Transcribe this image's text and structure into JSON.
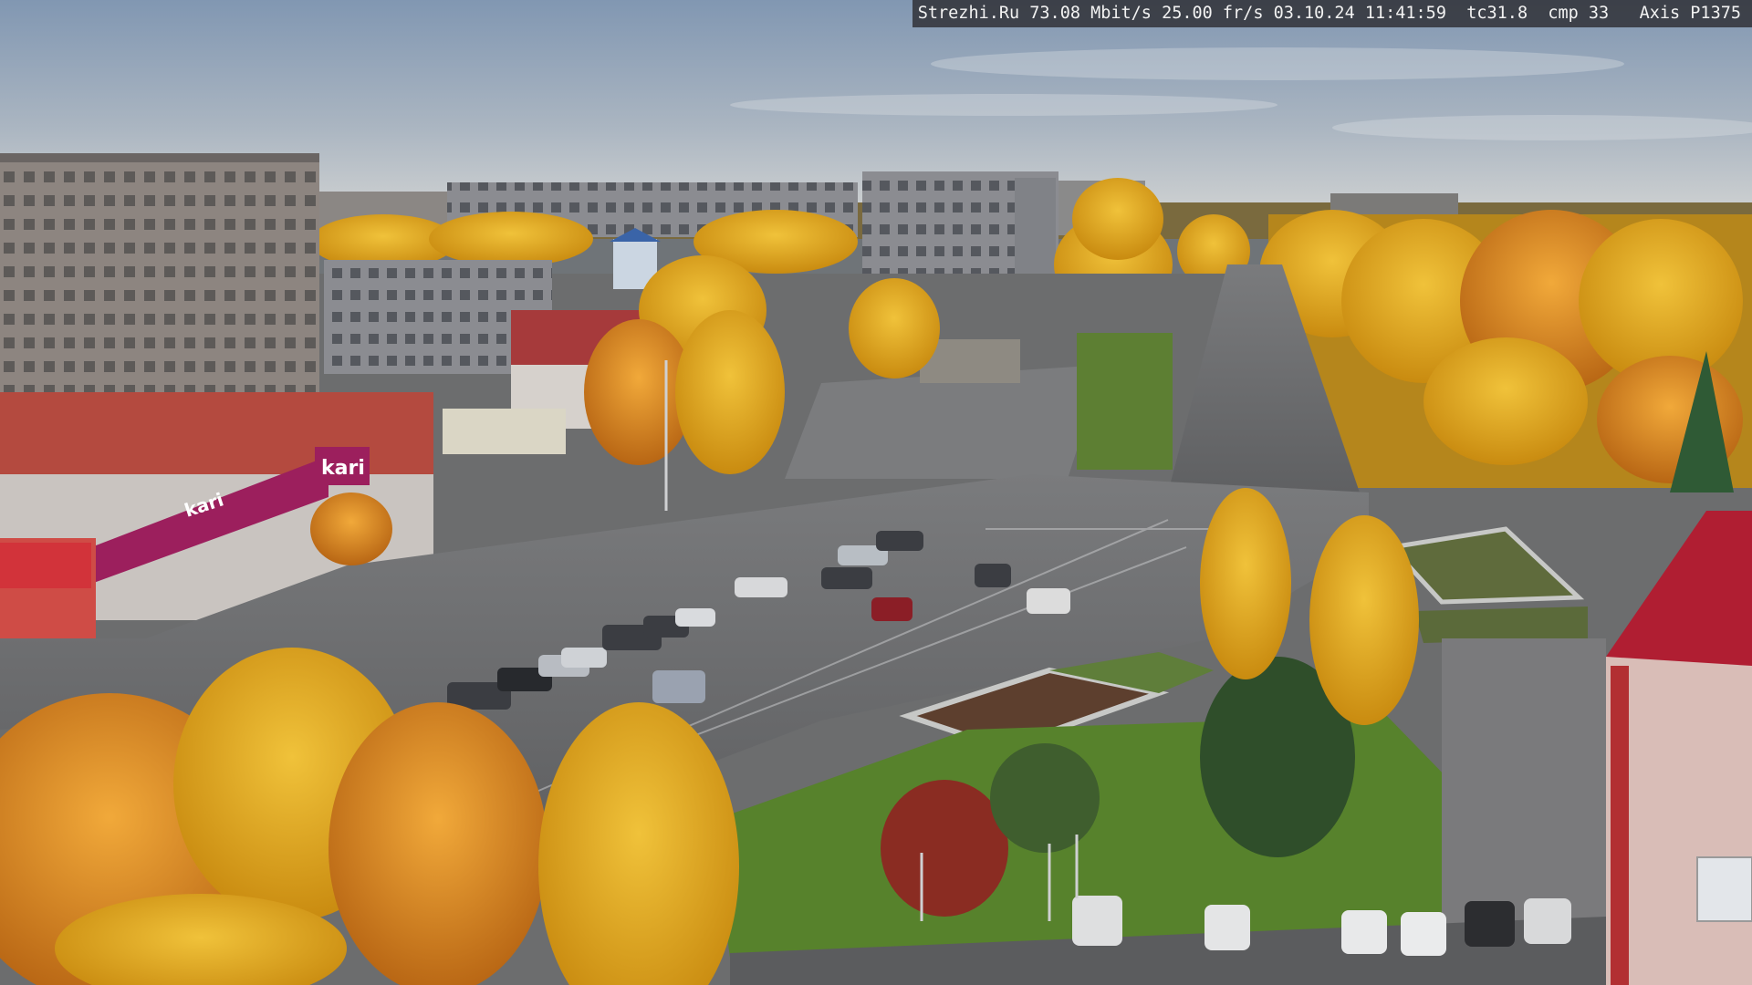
{
  "overlay": {
    "site": "Strezhi.Ru",
    "bitrate": "73.08 Mbit/s",
    "framerate": "25.00 fr/s",
    "date": "03.10.24",
    "time": "11:41:59",
    "tc": "tc31.8",
    "cmp": "cmp 33",
    "camera": "Axis P1375"
  },
  "signs": {
    "store_logo": "kari",
    "store_banner": "kari"
  },
  "colors": {
    "sky_top": "#8ea2b8",
    "sky_bottom": "#c9ced2",
    "asphalt": "#6a6b6d",
    "foliage": "#d9a21a",
    "grass": "#5a7d34",
    "brick": "#b8453a",
    "kari_sign": "#9c1f5d"
  }
}
